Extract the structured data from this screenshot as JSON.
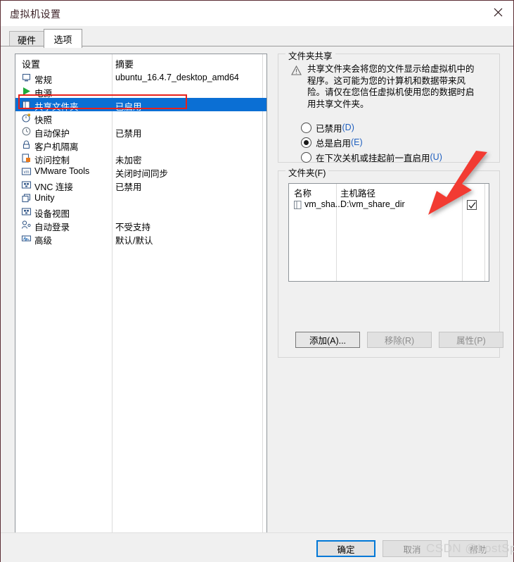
{
  "window": {
    "title": "虚拟机设置",
    "close_label": "✕",
    "border_color": "#5c2e35"
  },
  "tabs": [
    {
      "label": "硬件",
      "active": false
    },
    {
      "label": "选项",
      "active": true
    }
  ],
  "settings_list": {
    "columns": {
      "name": "设置",
      "summary": "摘要"
    },
    "selected_index": 2,
    "selection_color": "#0b6fd4",
    "rows": [
      {
        "icon": "monitor-icon",
        "label": "常规",
        "summary": "ubuntu_16.4.7_desktop_amd64"
      },
      {
        "icon": "play-icon",
        "label": "电源",
        "summary": ""
      },
      {
        "icon": "folder-icon",
        "label": "共享文件夹",
        "summary": "已启用"
      },
      {
        "icon": "snapshot-icon",
        "label": "快照",
        "summary": ""
      },
      {
        "icon": "clock-icon",
        "label": "自动保护",
        "summary": "已禁用"
      },
      {
        "icon": "lock-icon",
        "label": "客户机隔离",
        "summary": ""
      },
      {
        "icon": "access-lock-icon",
        "label": "访问控制",
        "summary": "未加密"
      },
      {
        "icon": "vmware-tools-icon",
        "label": "VMware Tools",
        "summary": "关闭时间同步"
      },
      {
        "icon": "vnc-icon",
        "label": "VNC 连接",
        "summary": "已禁用"
      },
      {
        "icon": "unity-icon",
        "label": "Unity",
        "summary": ""
      },
      {
        "icon": "device-view-icon",
        "label": "设备视图",
        "summary": ""
      },
      {
        "icon": "auto-login-icon",
        "label": "自动登录",
        "summary": "不受支持"
      },
      {
        "icon": "advanced-icon",
        "label": "高级",
        "summary": "默认/默认"
      }
    ]
  },
  "folder_sharing": {
    "group_title": "文件夹共享",
    "warning_icon": "warning-triangle-icon",
    "warning_text": "共享文件夹会将您的文件显示给虚拟机中的程序。这可能为您的计算机和数据带来风险。请仅在您信任虚拟机使用您的数据时启用共享文件夹。",
    "options": [
      {
        "label": "已禁用",
        "accel": "(D)",
        "checked": false
      },
      {
        "label": "总是启用",
        "accel": "(E)",
        "checked": true
      },
      {
        "label": "在下次关机或挂起前一直启用",
        "accel": "(U)",
        "checked": false
      }
    ]
  },
  "folders": {
    "group_title": "文件夹(F)",
    "columns": {
      "name": "名称",
      "path": "主机路径"
    },
    "rows": [
      {
        "icon": "folder-icon",
        "name": "vm_sha...",
        "path": "D:\\vm_share_dir",
        "enabled": true
      }
    ],
    "buttons": [
      {
        "label": "添加(A)...",
        "disabled": false
      },
      {
        "label": "移除(R)",
        "disabled": true
      },
      {
        "label": "属性(P)",
        "disabled": true
      }
    ]
  },
  "dialog_buttons": [
    {
      "label": "确定",
      "default": true
    },
    {
      "label": "取消",
      "default": false
    },
    {
      "label": "帮助",
      "default": false
    }
  ],
  "annotations": {
    "rect_color": "#e8211c",
    "arrow_color": "#f23a33"
  },
  "watermark": "CSDN @LostSpeed"
}
